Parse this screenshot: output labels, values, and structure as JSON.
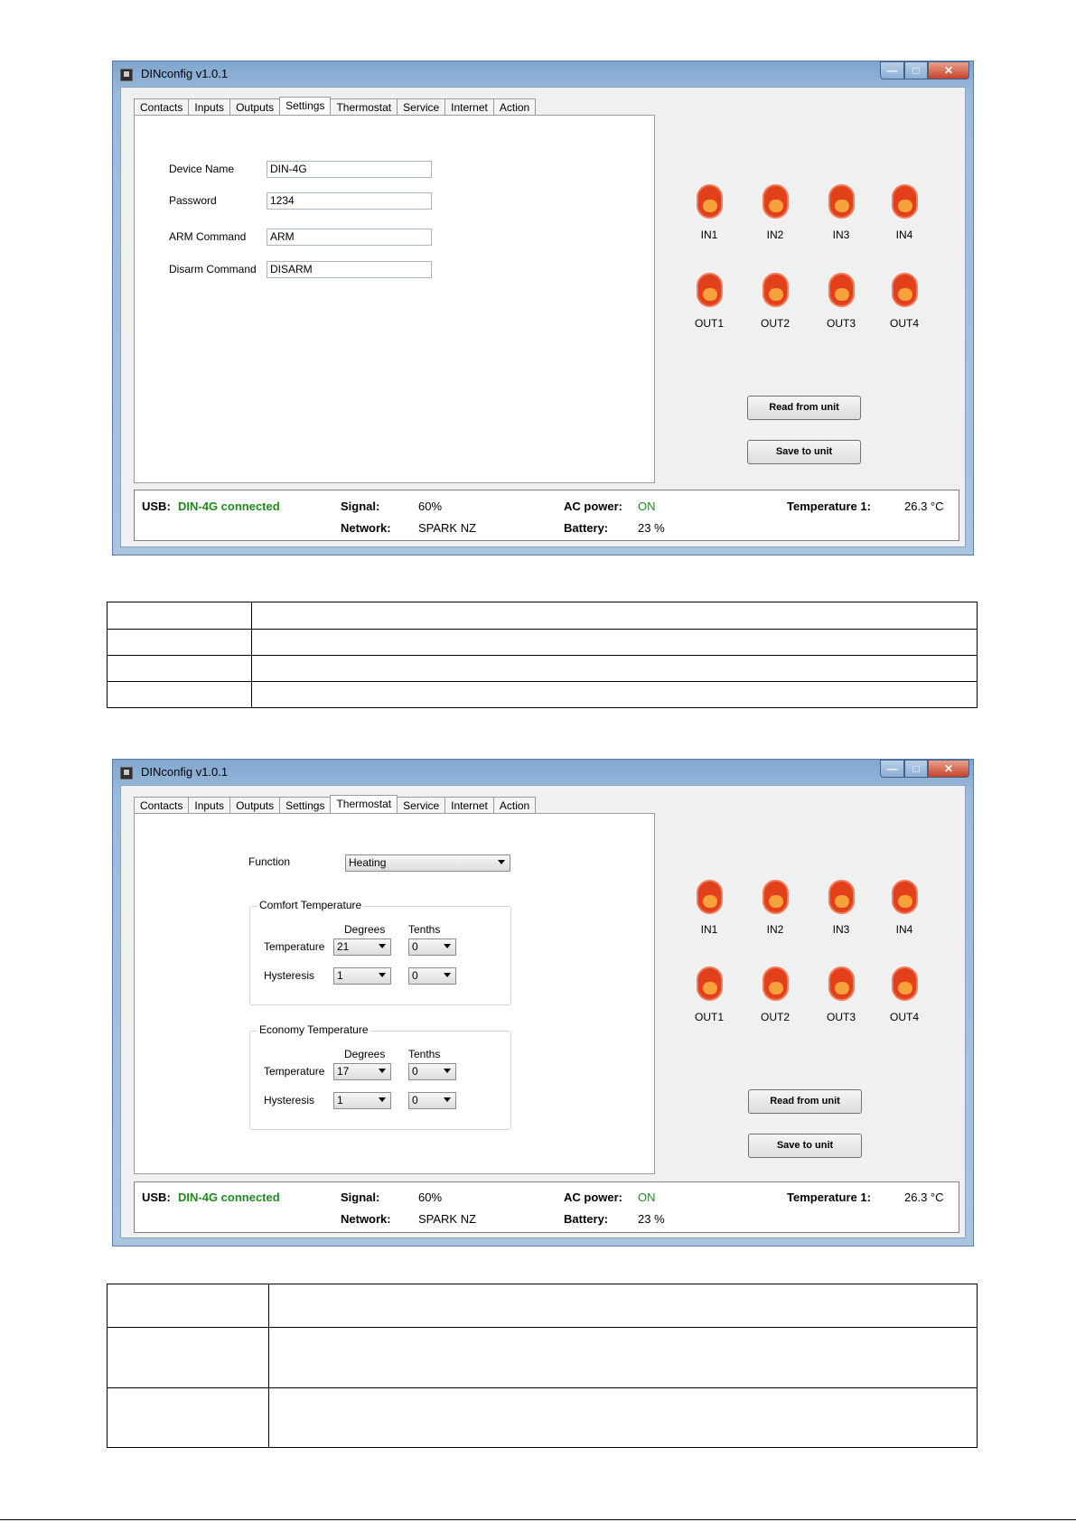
{
  "window1": {
    "title": "DINconfig v1.0.1",
    "tabs": [
      "Contacts",
      "Inputs",
      "Outputs",
      "Settings",
      "Thermostat",
      "Service",
      "Internet",
      "Action"
    ],
    "active_tab": "Settings",
    "settings": {
      "device_name_label": "Device Name",
      "device_name_value": "DIN-4G",
      "password_label": "Password",
      "password_value": "1234",
      "arm_label": "ARM Command",
      "arm_value": "ARM",
      "disarm_label": "Disarm Command",
      "disarm_value": "DISARM"
    }
  },
  "window2": {
    "title": "DINconfig v1.0.1",
    "tabs": [
      "Contacts",
      "Inputs",
      "Outputs",
      "Settings",
      "Thermostat",
      "Service",
      "Internet",
      "Action"
    ],
    "active_tab": "Thermostat",
    "thermostat": {
      "function_label": "Function",
      "function_value": "Heating",
      "comfort": {
        "title": "Comfort Temperature",
        "degrees_header": "Degrees",
        "tenths_header": "Tenths",
        "temperature_label": "Temperature",
        "temperature_degrees": "21",
        "temperature_tenths": "0",
        "hysteresis_label": "Hysteresis",
        "hysteresis_degrees": "1",
        "hysteresis_tenths": "0"
      },
      "economy": {
        "title": "Economy Temperature",
        "degrees_header": "Degrees",
        "tenths_header": "Tenths",
        "temperature_label": "Temperature",
        "temperature_degrees": "17",
        "temperature_tenths": "0",
        "hysteresis_label": "Hysteresis",
        "hysteresis_degrees": "1",
        "hysteresis_tenths": "0"
      }
    }
  },
  "indicators": {
    "inputs": [
      "IN1",
      "IN2",
      "IN3",
      "IN4"
    ],
    "outputs": [
      "OUT1",
      "OUT2",
      "OUT3",
      "OUT4"
    ],
    "led_color": "#e2401b"
  },
  "buttons": {
    "read": "Read from unit",
    "save": "Save to unit"
  },
  "status": {
    "usb_label": "USB:",
    "usb_value": "DIN-4G connected",
    "signal_label": "Signal:",
    "signal_value": "60%",
    "network_label": "Network:",
    "network_value": "SPARK NZ",
    "ac_label": "AC power:",
    "ac_value": "ON",
    "battery_label": "Battery:",
    "battery_value": "23 %",
    "temp_label": "Temperature 1:",
    "temp_value": "26.3 °C",
    "ok_color": "#1f8b1f"
  }
}
